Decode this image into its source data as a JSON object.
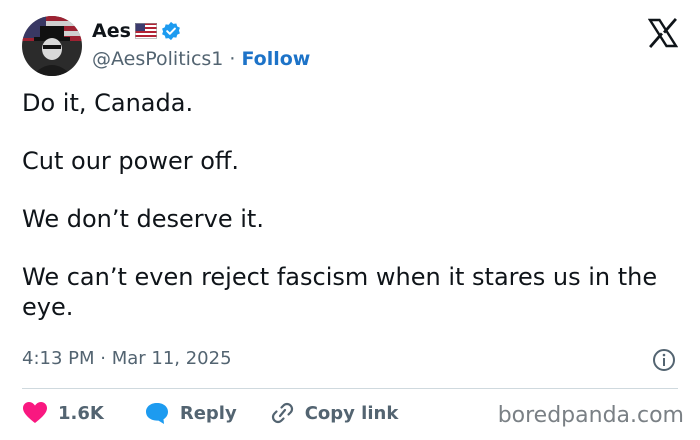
{
  "tweet": {
    "display_name": "Aes",
    "handle": "@AesPolitics1",
    "separator": "·",
    "follow_label": "Follow",
    "paragraphs": [
      "Do it, Canada.",
      "Cut our power off.",
      "We don’t deserve it.",
      "We can’t even reject fascism when it stares us in the eye."
    ],
    "timestamp": "4:13 PM · Mar 11, 2025"
  },
  "actions": {
    "likes_count": "1.6K",
    "reply_label": "Reply",
    "copy_link_label": "Copy link"
  },
  "watermark": "boredpanda.com",
  "icons": {
    "avatar": "profile-avatar",
    "flag": "us-flag-icon",
    "verified": "verified-badge-icon",
    "logo": "x-logo-icon",
    "info": "info-icon",
    "like": "heart-icon",
    "reply": "reply-bubble-icon",
    "copy": "link-icon"
  },
  "colors": {
    "accent": "#1d73c8",
    "like": "#f91880",
    "text": "#0f1419",
    "muted": "#536471"
  }
}
